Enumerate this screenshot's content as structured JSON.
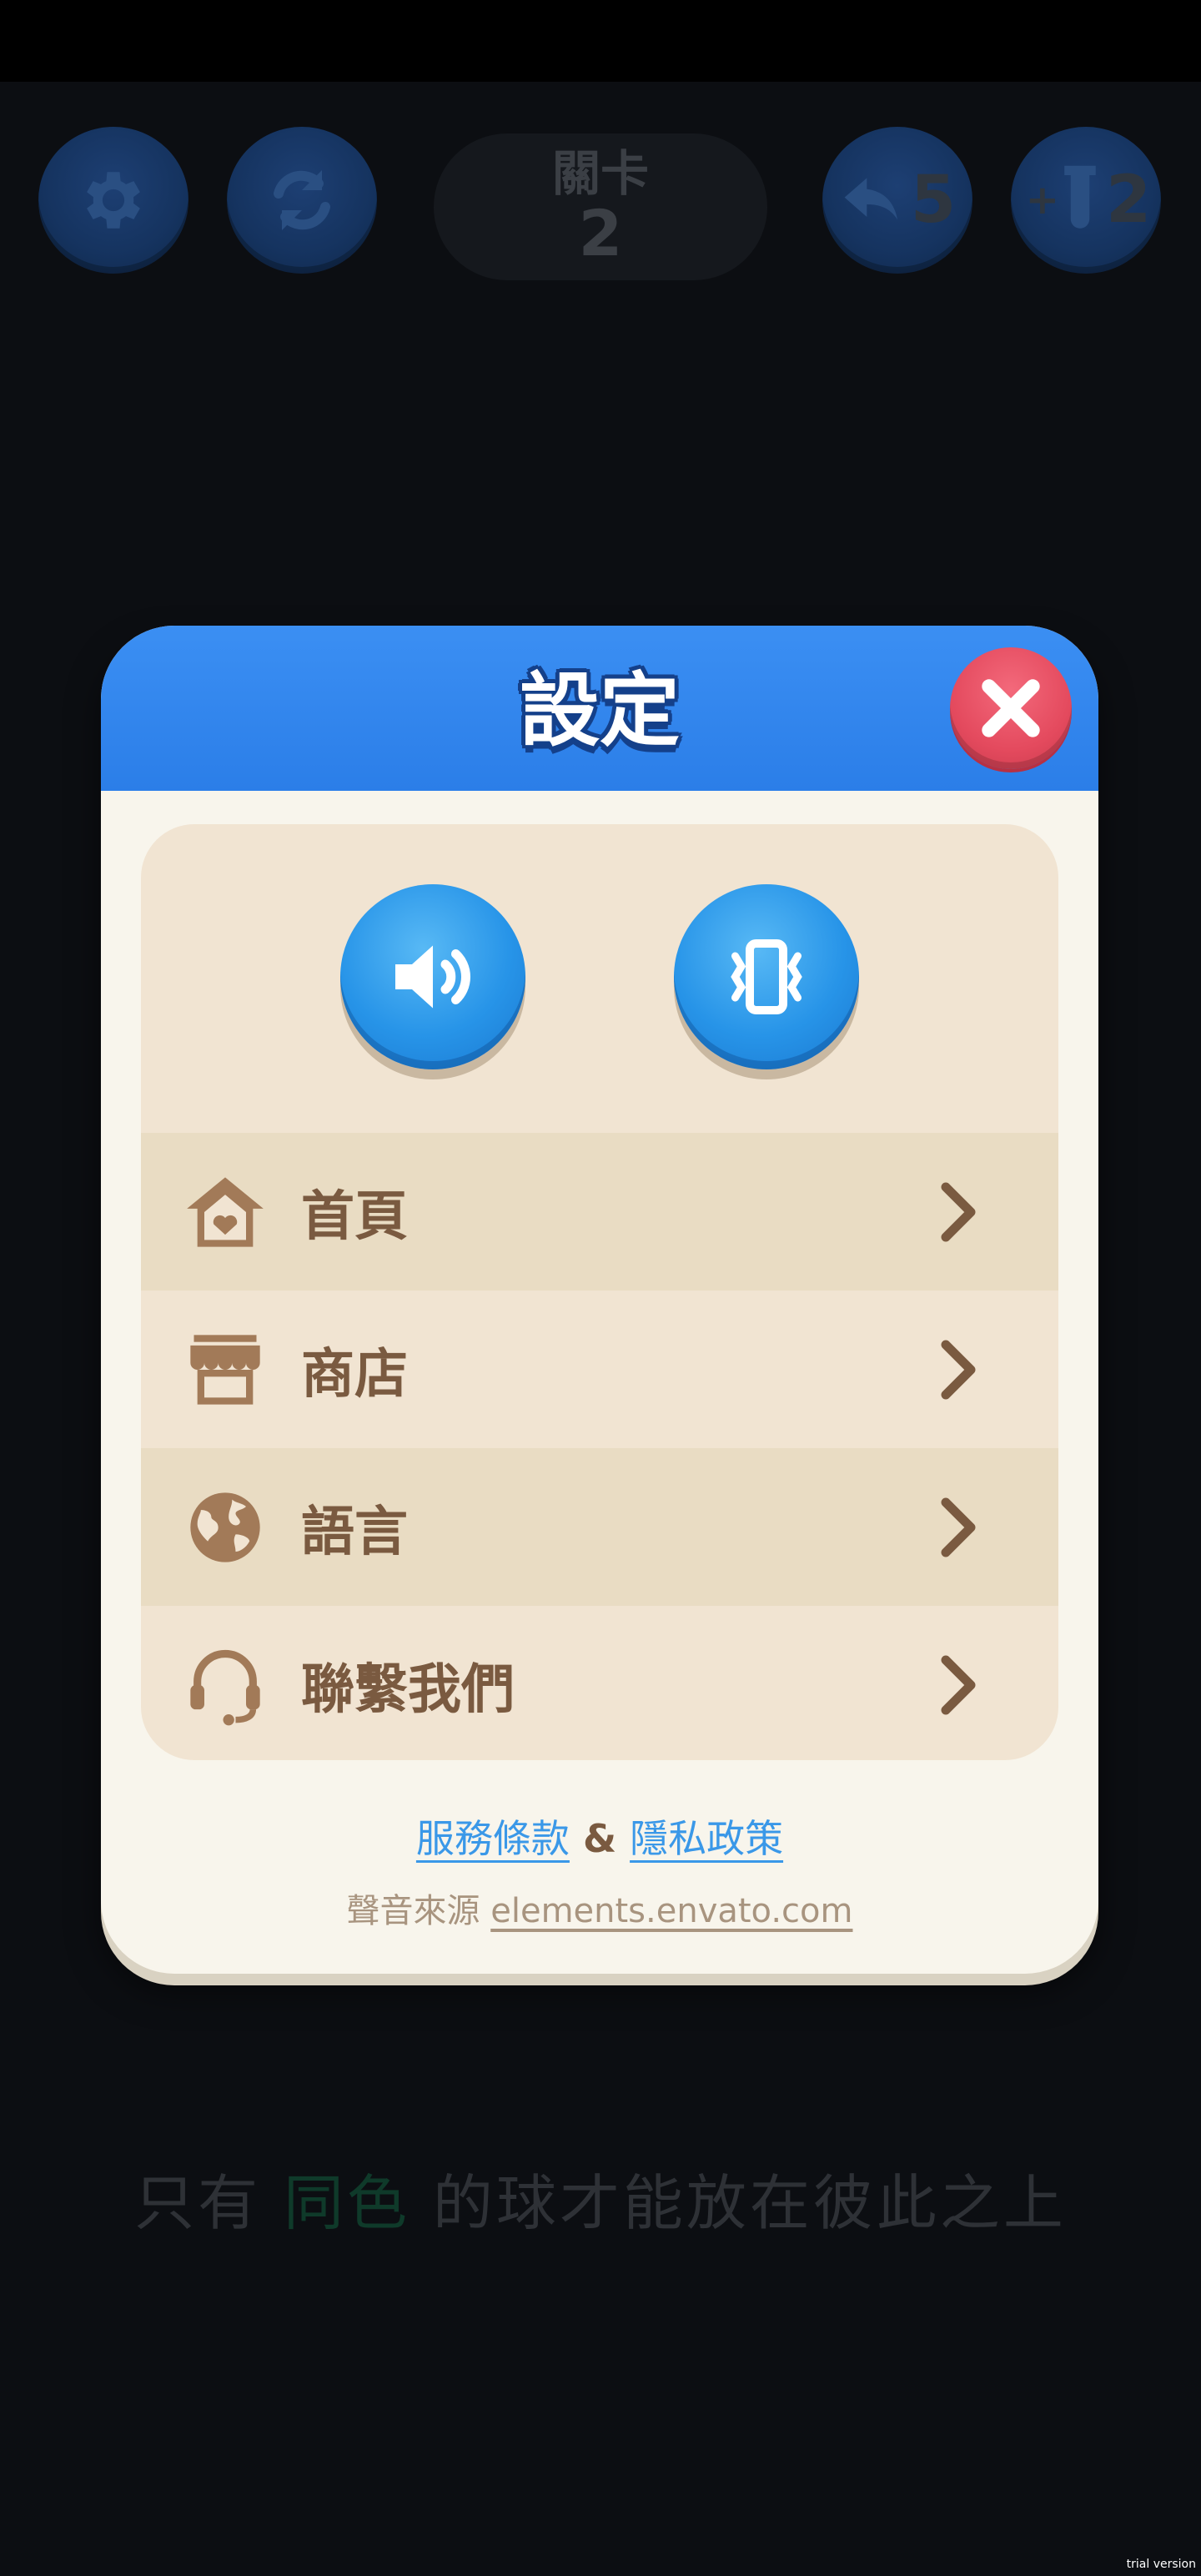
{
  "hud": {
    "level_label": "關卡",
    "level_number": "2",
    "undo_count": "5",
    "tube_count": "2",
    "tube_prefix": "+"
  },
  "modal": {
    "title": "設定",
    "menu": [
      {
        "label": "首頁",
        "icon": "home-icon"
      },
      {
        "label": "商店",
        "icon": "shop-icon"
      },
      {
        "label": "語言",
        "icon": "globe-icon"
      },
      {
        "label": "聯繫我們",
        "icon": "headset-icon"
      }
    ],
    "terms_link": "服務條款",
    "amp": "&",
    "privacy_link": "隱私政策",
    "sound_source_prefix": "聲音來源",
    "sound_source_link": "elements.envato.com"
  },
  "hint": {
    "before": "只有",
    "highlight": "同色",
    "after": "的球才能放在彼此之上"
  },
  "watermark": "trial version",
  "colors": {
    "header_blue": "#2b7ee8",
    "close_red": "#e44a5e",
    "panel_tan": "#f1e4d2",
    "row_alt": "#e9dcc3",
    "label_brown": "#7a5a40",
    "link_blue": "#3a98e8"
  }
}
